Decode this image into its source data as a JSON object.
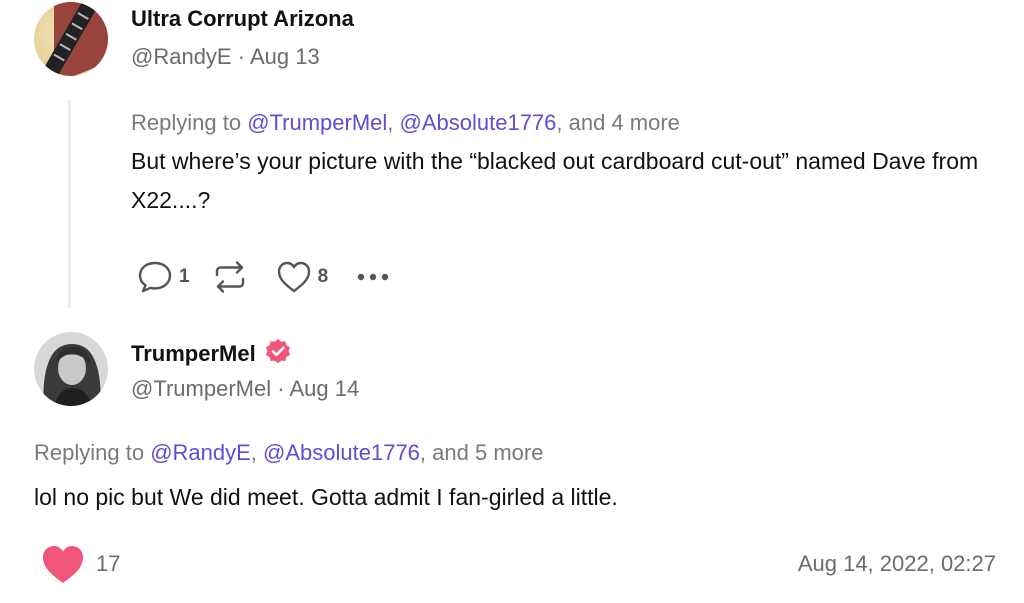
{
  "post1": {
    "display_name": "Ultra Corrupt Arizona",
    "handle": "@RandyE",
    "separator": "·",
    "date": "Aug 13",
    "replying_prefix": "Replying to ",
    "mentions": [
      "@TrumperMel",
      "@Absolute1776"
    ],
    "comma": ", ",
    "and_more": ", and 4 more",
    "text": "But where’s your picture with the “blacked out cardboard cut-out” named Dave from X22....?",
    "actions": {
      "comment_icon": "comment-icon",
      "comments": "1",
      "restack_icon": "restack-icon",
      "like_icon": "heart-outline-icon",
      "likes": "8",
      "more_icon": "more-dots-icon"
    }
  },
  "post2": {
    "display_name": "TrumperMel",
    "verified_icon": "verified-badge-icon",
    "handle": "@TrumperMel",
    "separator": "·",
    "date": "Aug 14",
    "replying_prefix": "Replying to ",
    "mentions": [
      "@RandyE",
      "@Absolute1776"
    ],
    "comma": ", ",
    "and_more": ", and 5 more",
    "text": "lol no pic but We did meet. Gotta admit I fan-girled a little.",
    "like_icon": "heart-filled-icon",
    "likes": "17",
    "timestamp": "Aug 14, 2022, 02:27"
  },
  "colors": {
    "mention": "#5b4fd6",
    "verified": "#f2557a",
    "heart": "#f2557a",
    "muted": "#6b6b6b"
  }
}
